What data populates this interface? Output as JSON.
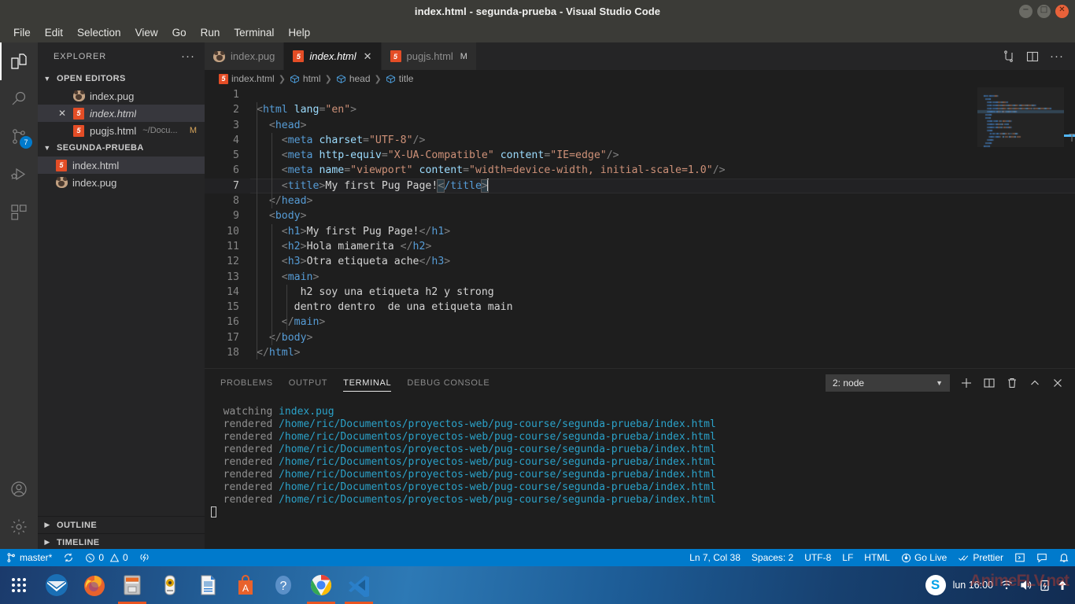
{
  "window": {
    "title": "index.html - segunda-prueba - Visual Studio Code",
    "minimize": "minimize",
    "maximize": "maximize",
    "close": "close"
  },
  "menubar": [
    "File",
    "Edit",
    "Selection",
    "View",
    "Go",
    "Run",
    "Terminal",
    "Help"
  ],
  "activitybar": {
    "items": [
      {
        "name": "explorer",
        "icon": "files-icon",
        "active": true,
        "badge": ""
      },
      {
        "name": "search",
        "icon": "search-icon",
        "active": false,
        "badge": ""
      },
      {
        "name": "source-control",
        "icon": "source-control-icon",
        "active": false,
        "badge": "7"
      },
      {
        "name": "run-debug",
        "icon": "run-debug-icon",
        "active": false,
        "badge": ""
      },
      {
        "name": "extensions",
        "icon": "extensions-icon",
        "active": false,
        "badge": ""
      }
    ],
    "bottom": [
      {
        "name": "accounts",
        "icon": "account-icon"
      },
      {
        "name": "settings",
        "icon": "gear-icon"
      }
    ]
  },
  "sidebar": {
    "title": "EXPLORER",
    "more_actions": "···",
    "open_editors": {
      "label": "OPEN EDITORS",
      "items": [
        {
          "name": "index.pug",
          "icon": "pug-icon",
          "selected": false,
          "italic": false,
          "close": false,
          "path": "",
          "modified": ""
        },
        {
          "name": "index.html",
          "icon": "html5-icon",
          "selected": true,
          "italic": true,
          "close": true,
          "path": "",
          "modified": ""
        },
        {
          "name": "pugjs.html",
          "icon": "html5-icon",
          "selected": false,
          "italic": false,
          "close": false,
          "path": "~/Docu...",
          "modified": "M"
        }
      ]
    },
    "folder": {
      "label": "SEGUNDA-PRUEBA",
      "items": [
        {
          "name": "index.html",
          "icon": "html5-icon",
          "selected": true
        },
        {
          "name": "index.pug",
          "icon": "pug-icon",
          "selected": false
        }
      ]
    },
    "outline_label": "OUTLINE",
    "timeline_label": "TIMELINE"
  },
  "tabs": [
    {
      "label": "index.pug",
      "icon": "pug-icon",
      "active": false,
      "italic": false,
      "close": false,
      "modified": ""
    },
    {
      "label": "index.html",
      "icon": "html5-icon",
      "active": true,
      "italic": true,
      "close": true,
      "modified": ""
    },
    {
      "label": "pugjs.html",
      "icon": "html5-icon",
      "active": false,
      "italic": false,
      "close": false,
      "modified": "M"
    }
  ],
  "editor_actions": [
    {
      "name": "split-editor-icon",
      "label": "split"
    },
    {
      "name": "open-changes-icon",
      "label": "changes"
    },
    {
      "name": "more-actions-icon",
      "label": "···"
    }
  ],
  "breadcrumbs": [
    {
      "label": "index.html",
      "icon": "html5-icon"
    },
    {
      "label": "html",
      "icon": "symbol-icon"
    },
    {
      "label": "head",
      "icon": "symbol-icon"
    },
    {
      "label": "title",
      "icon": "symbol-icon"
    }
  ],
  "code": {
    "current_line": 7,
    "lines": [
      {
        "n": 1,
        "text": ""
      },
      {
        "n": 2,
        "text": "<html lang=\"en\">"
      },
      {
        "n": 3,
        "text": "  <head>"
      },
      {
        "n": 4,
        "text": "    <meta charset=\"UTF-8\"/>"
      },
      {
        "n": 5,
        "text": "    <meta http-equiv=\"X-UA-Compatible\" content=\"IE=edge\"/>"
      },
      {
        "n": 6,
        "text": "    <meta name=\"viewport\" content=\"width=device-width, initial-scale=1.0\"/>"
      },
      {
        "n": 7,
        "text": "    <title>My first Pug Page!</title>"
      },
      {
        "n": 8,
        "text": "  </head>"
      },
      {
        "n": 9,
        "text": "  <body>"
      },
      {
        "n": 10,
        "text": "    <h1>My first Pug Page!</h1>"
      },
      {
        "n": 11,
        "text": "    <h2>Hola miamerita </h2>"
      },
      {
        "n": 12,
        "text": "    <h3>Otra etiqueta ache</h3>"
      },
      {
        "n": 13,
        "text": "    <main>"
      },
      {
        "n": 14,
        "text": "       h2 soy una etiqueta h2 y strong"
      },
      {
        "n": 15,
        "text": "      dentro dentro  de una etiqueta main"
      },
      {
        "n": 16,
        "text": "    </main>"
      },
      {
        "n": 17,
        "text": "  </body>"
      },
      {
        "n": 18,
        "text": "</html>"
      }
    ]
  },
  "panel": {
    "tabs": [
      {
        "label": "PROBLEMS",
        "active": false
      },
      {
        "label": "OUTPUT",
        "active": false
      },
      {
        "label": "TERMINAL",
        "active": true
      },
      {
        "label": "DEBUG CONSOLE",
        "active": false
      }
    ],
    "terminal_select": "2: node",
    "actions": [
      {
        "name": "new-terminal-icon",
        "label": "+"
      },
      {
        "name": "split-terminal-icon",
        "label": "split"
      },
      {
        "name": "kill-terminal-icon",
        "label": "trash"
      },
      {
        "name": "maximize-panel-icon",
        "label": "^"
      },
      {
        "name": "close-panel-icon",
        "label": "×"
      }
    ],
    "terminal_lines": [
      {
        "label": "watching",
        "value": "index.pug"
      },
      {
        "label": "rendered",
        "value": "/home/ric/Documentos/proyectos-web/pug-course/segunda-prueba/index.html"
      },
      {
        "label": "rendered",
        "value": "/home/ric/Documentos/proyectos-web/pug-course/segunda-prueba/index.html"
      },
      {
        "label": "rendered",
        "value": "/home/ric/Documentos/proyectos-web/pug-course/segunda-prueba/index.html"
      },
      {
        "label": "rendered",
        "value": "/home/ric/Documentos/proyectos-web/pug-course/segunda-prueba/index.html"
      },
      {
        "label": "rendered",
        "value": "/home/ric/Documentos/proyectos-web/pug-course/segunda-prueba/index.html"
      },
      {
        "label": "rendered",
        "value": "/home/ric/Documentos/proyectos-web/pug-course/segunda-prueba/index.html"
      },
      {
        "label": "rendered",
        "value": "/home/ric/Documentos/proyectos-web/pug-course/segunda-prueba/index.html"
      }
    ]
  },
  "statusbar": {
    "accent": "#007acc",
    "branch": "master*",
    "sync": "sync-icon",
    "errors": "0",
    "warnings": "0",
    "radio": "radio-tower-icon",
    "position": "Ln 7, Col 38",
    "spaces": "Spaces: 2",
    "encoding": "UTF-8",
    "eol": "LF",
    "language": "HTML",
    "golive": "Go Live",
    "prettier": "Prettier",
    "remote": "remote-icon",
    "feedback": "feedback-icon",
    "bell": "bell-icon"
  },
  "taskbar": {
    "apps": [
      {
        "name": "show-applications",
        "running": false
      },
      {
        "name": "thunderbird",
        "running": false
      },
      {
        "name": "firefox",
        "running": false
      },
      {
        "name": "files",
        "running": true
      },
      {
        "name": "rhythmbox",
        "running": false
      },
      {
        "name": "libreoffice-writer",
        "running": false
      },
      {
        "name": "ubuntu-software",
        "running": false
      },
      {
        "name": "help",
        "running": false
      },
      {
        "name": "google-chrome",
        "running": true
      },
      {
        "name": "visual-studio-code",
        "running": true
      }
    ],
    "skype": "S",
    "clock": "lun 16:00",
    "tray": [
      "wifi-icon",
      "volume-icon",
      "battery-icon",
      "power-icon"
    ],
    "watermark": "AnimeFLV.net"
  }
}
